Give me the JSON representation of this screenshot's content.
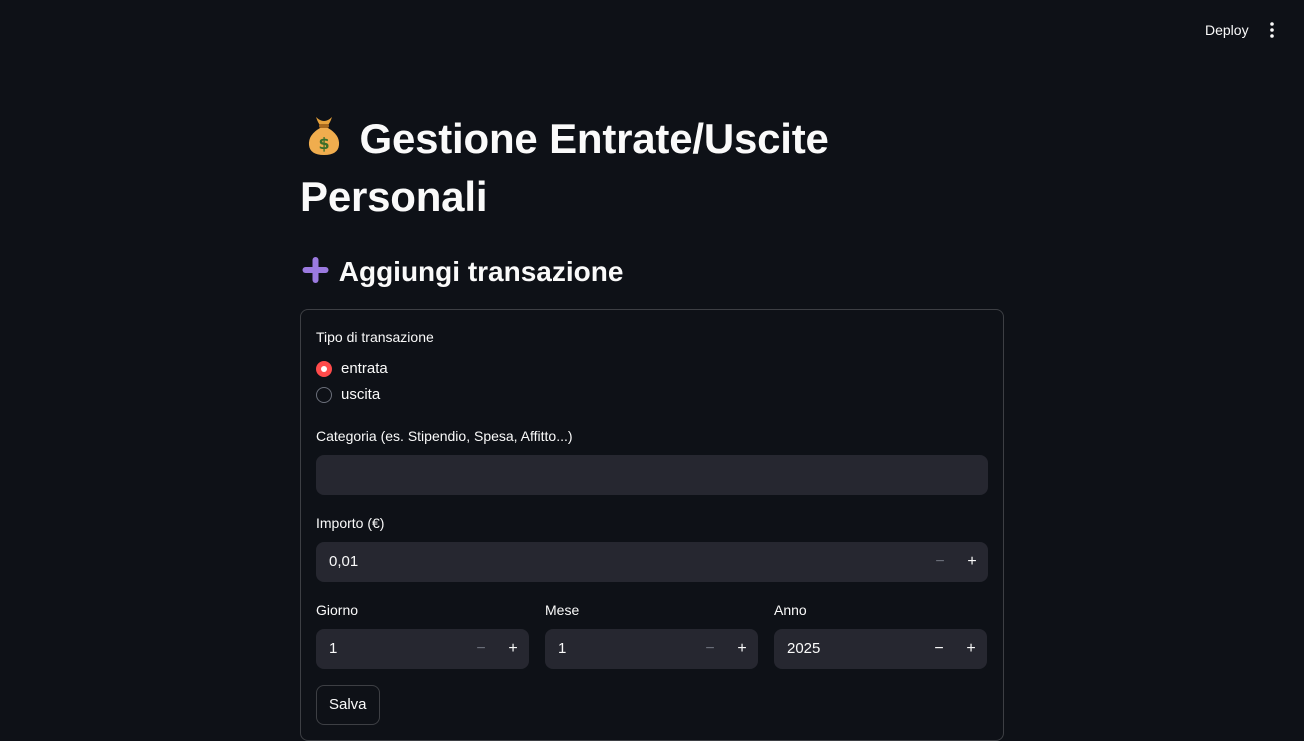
{
  "header": {
    "deploy_label": "Deploy",
    "menu_icon": "vertical-dots-icon"
  },
  "page": {
    "title": "Gestione Entrate/Uscite Personali",
    "title_icon": "money-bag-icon"
  },
  "section": {
    "title": "Aggiungi transazione",
    "title_icon": "plus-icon"
  },
  "form": {
    "type_label": "Tipo di transazione",
    "type_options": [
      "entrata",
      "uscita"
    ],
    "type_selected": "entrata",
    "category_label": "Categoria (es. Stipendio, Spesa, Affitto...)",
    "category_value": "",
    "amount_label": "Importo (€)",
    "amount_value": "0,01",
    "day_label": "Giorno",
    "day_value": "1",
    "month_label": "Mese",
    "month_value": "1",
    "year_label": "Anno",
    "year_value": "2025",
    "submit_label": "Salva"
  },
  "colors": {
    "background": "#0e1117",
    "input_background": "#262730",
    "accent": "#ff4b4b",
    "text": "#fafafa"
  }
}
